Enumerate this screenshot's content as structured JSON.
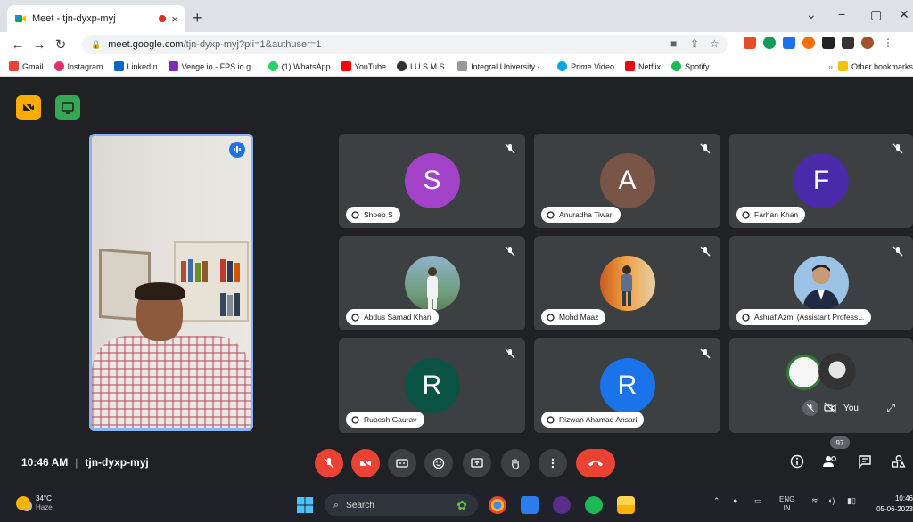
{
  "browser": {
    "tab_title": "Meet - tjn-dyxp-myj",
    "tab_close": "×",
    "new_tab": "+",
    "url_host": "meet.google.com",
    "url_path": "/tjn-dyxp-myj?pli=1&authuser=1",
    "bookmarks": [
      "Gmail",
      "Instagram",
      "LinkedIn",
      "Venge.io - FPS io g...",
      "(1) WhatsApp",
      "YouTube",
      "I.U.S.M.S.",
      "Integral University -...",
      "Prime Video",
      "Netflix",
      "Spotify"
    ],
    "other_bookmarks": "Other bookmarks"
  },
  "meeting": {
    "code": "tjn-dyxp-myj",
    "time": "10:46 AM",
    "participant_count": "97",
    "self_label": "You"
  },
  "participants": [
    {
      "name": "Shoeb S",
      "initial": "S",
      "color": "#a142c8",
      "photo": false
    },
    {
      "name": "Anuradha Tiwari",
      "initial": "A",
      "color": "#795548",
      "photo": false
    },
    {
      "name": "Farhan Khan",
      "initial": "F",
      "color": "#4a2aa8",
      "photo": false
    },
    {
      "name": "Abdus Samad Khan",
      "initial": "",
      "color": "#7aa0b8",
      "photo": true
    },
    {
      "name": "Mohd Maaz",
      "initial": "",
      "color": "#d9822b",
      "photo": true
    },
    {
      "name": "Ashraf Azmi (Assistant Profess...",
      "initial": "",
      "color": "#9cc3e6",
      "photo": true
    },
    {
      "name": "Rupesh Gaurav",
      "initial": "R",
      "color": "#0b5345",
      "photo": false
    },
    {
      "name": "Rizwan Ahamad Ansari",
      "initial": "R",
      "color": "#1a73e8",
      "photo": false
    }
  ],
  "taskbar": {
    "temperature": "34°C",
    "condition": "Haze",
    "search_placeholder": "Search",
    "lang": "ENG",
    "region": "IN",
    "time": "10:46",
    "date": "05-06-2023"
  }
}
